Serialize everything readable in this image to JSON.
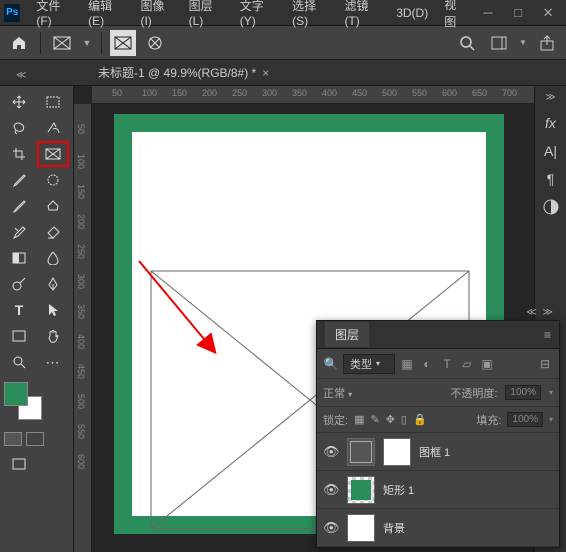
{
  "menu": [
    "文件(F)",
    "编辑(E)",
    "图像(I)",
    "图层(L)",
    "文字(Y)",
    "选择(S)",
    "滤镜(T)",
    "3D(D)",
    "视图"
  ],
  "doc_tab": "未标题-1 @ 49.9%(RGB/8#) *",
  "ruler_h": [
    "50",
    "100",
    "150",
    "200",
    "250",
    "300",
    "350",
    "400",
    "450",
    "500",
    "550",
    "600",
    "650",
    "700"
  ],
  "ruler_v": [
    "50",
    "100",
    "150",
    "200",
    "250",
    "300",
    "350",
    "400",
    "450",
    "500",
    "550",
    "600"
  ],
  "colors": {
    "fg": "#2a8d5a",
    "bg": "#ffffff"
  },
  "layers": {
    "tab": "图层",
    "filter_label": "类型",
    "blend_mode": "正常",
    "opacity_label": "不透明度:",
    "opacity_val": "100%",
    "lock_label": "锁定:",
    "fill_label": "填充:",
    "fill_val": "100%",
    "items": [
      {
        "name": "图框 1",
        "type": "frame"
      },
      {
        "name": "矩形 1",
        "type": "shape"
      },
      {
        "name": "背景",
        "type": "bg"
      }
    ]
  }
}
